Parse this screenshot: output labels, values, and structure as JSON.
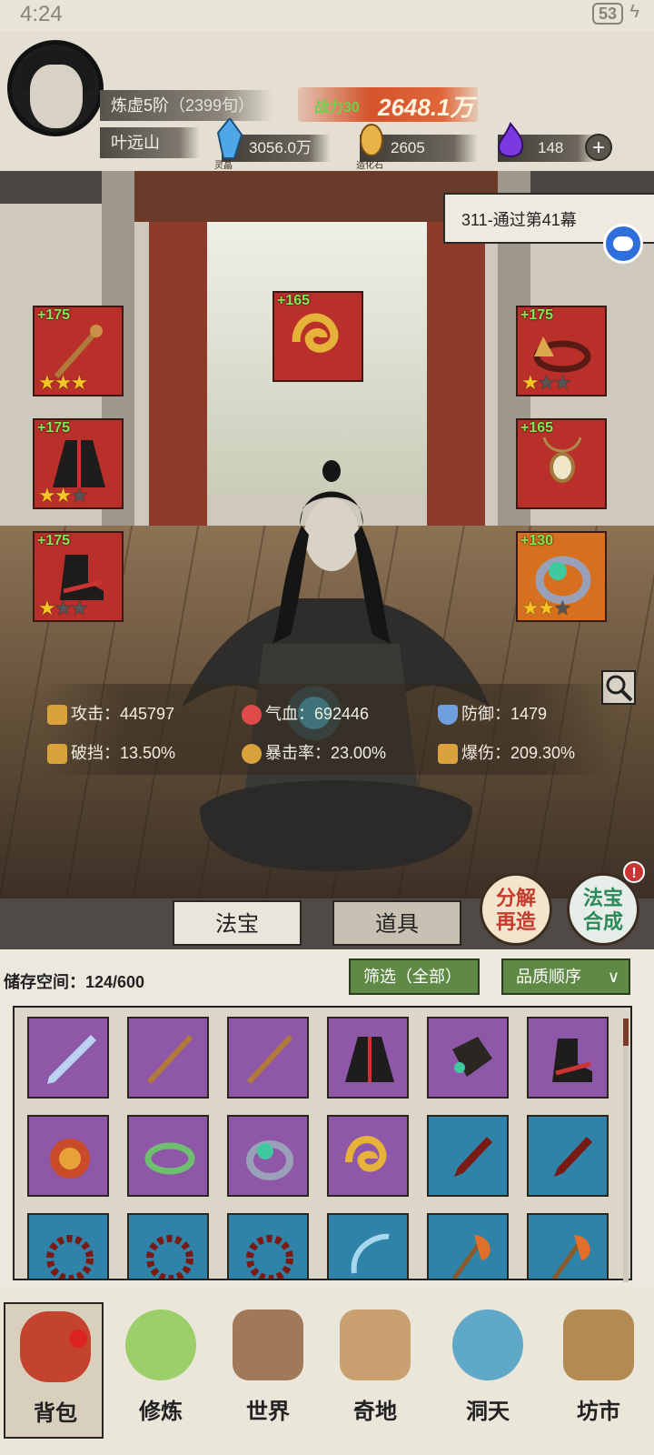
{
  "status_bar": {
    "time": "4:24",
    "battery": "53"
  },
  "player": {
    "realm": "炼虚5阶",
    "days": "（2399旬）",
    "name": "叶远山",
    "power_label": "战力",
    "power_overlap": "30",
    "power_value": "2648.1万"
  },
  "resources": [
    {
      "icon": "spirit-crystal-icon",
      "label": "灵晶",
      "value": "3056.0万"
    },
    {
      "icon": "creation-stone-icon",
      "label": "造化石",
      "value": "2605"
    },
    {
      "icon": "purple-flame-icon",
      "label": "",
      "value": "148"
    }
  ],
  "task_banner": "311-通过第41幕",
  "equipment_slots": [
    {
      "id": "weapon-staff",
      "level": "+175",
      "stars": 3,
      "color": "red"
    },
    {
      "id": "crown",
      "level": "+165",
      "stars": 0,
      "color": "red"
    },
    {
      "id": "headband",
      "level": "+175",
      "stars": 1,
      "color": "red"
    },
    {
      "id": "robe",
      "level": "+175",
      "stars": 2,
      "color": "red"
    },
    {
      "id": "amulet",
      "level": "+165",
      "stars": 0,
      "color": "red"
    },
    {
      "id": "boots",
      "level": "+175",
      "stars": 1,
      "color": "red"
    },
    {
      "id": "ring",
      "level": "+130",
      "stars": 2,
      "color": "orange"
    }
  ],
  "stats": {
    "attack": "攻击：445797",
    "hp": "气血：692446",
    "defense": "防御：1479",
    "penetration": "破挡：13.50%",
    "crit_rate": "暴击率：23.00%",
    "crit_damage": "爆伤：209.30%"
  },
  "actions": {
    "decompose": "分解再造",
    "decompose_l1": "分解",
    "decompose_l2": "再造",
    "synth_l1": "法宝",
    "synth_l2": "合成",
    "notif": "!"
  },
  "tabs": {
    "treasure": "法宝",
    "items": "道具"
  },
  "inventory": {
    "storage_label": "储存空间：124/600",
    "filter": "筛选（全部）",
    "sort": "品质顺序",
    "items": [
      {
        "icon": "sword-icon",
        "color": "purple"
      },
      {
        "icon": "staff-icon",
        "color": "purple"
      },
      {
        "icon": "staff-icon",
        "color": "purple"
      },
      {
        "icon": "robe-icon",
        "color": "purple"
      },
      {
        "icon": "bracer-icon",
        "color": "purple"
      },
      {
        "icon": "boots-icon",
        "color": "purple"
      },
      {
        "icon": "helmet-icon",
        "color": "purple"
      },
      {
        "icon": "wreath-icon",
        "color": "purple"
      },
      {
        "icon": "ring-icon",
        "color": "purple"
      },
      {
        "icon": "cloud-crown-icon",
        "color": "purple"
      },
      {
        "icon": "dagger-icon",
        "color": "blue"
      },
      {
        "icon": "dagger-icon",
        "color": "blue"
      },
      {
        "icon": "thorn-ring-icon",
        "color": "blue"
      },
      {
        "icon": "thorn-ring-icon",
        "color": "blue"
      },
      {
        "icon": "thorn-ring-icon",
        "color": "blue"
      },
      {
        "icon": "bow-icon",
        "color": "blue"
      },
      {
        "icon": "axe-icon",
        "color": "blue"
      },
      {
        "icon": "axe-icon",
        "color": "blue"
      }
    ]
  },
  "nav": [
    {
      "label": "背包",
      "active": true
    },
    {
      "label": "修炼",
      "active": false
    },
    {
      "label": "世界",
      "active": false
    },
    {
      "label": "奇地",
      "active": false
    },
    {
      "label": "洞天",
      "active": false
    },
    {
      "label": "坊市",
      "active": false
    }
  ],
  "colors": {
    "slot_red": "#b9302b",
    "slot_orange": "#d6701e",
    "cell_purple": "#8e57a8",
    "cell_blue": "#2f83a8",
    "filter_green": "#5f8a45"
  }
}
